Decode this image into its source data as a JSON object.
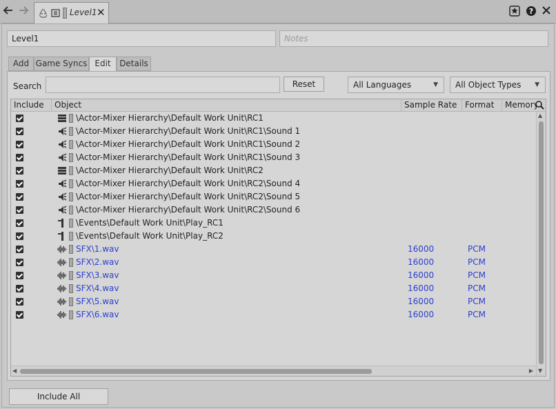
{
  "window": {
    "tab_title": "Level1",
    "back_icon": "arrow-left-icon",
    "forward_icon": "arrow-right-icon",
    "close_glyph": "✕"
  },
  "form": {
    "name_value": "Level1",
    "notes_placeholder": "Notes"
  },
  "tabs": [
    {
      "label": "Add"
    },
    {
      "label": "Game Syncs"
    },
    {
      "label": "Edit"
    },
    {
      "label": "Details"
    }
  ],
  "active_tab": "Edit",
  "search": {
    "label": "Search",
    "value": "",
    "reset_label": "Reset"
  },
  "filters": {
    "language": "All Languages",
    "object_types": "All Object Types"
  },
  "table": {
    "columns": [
      "Include",
      "Object",
      "Sample Rate",
      "Format",
      "Memory"
    ],
    "rows": [
      {
        "included": true,
        "icon": "container-icon",
        "object": "\\Actor-Mixer Hierarchy\\Default Work Unit\\RC1",
        "sample_rate": "",
        "format": "",
        "audio": false
      },
      {
        "included": true,
        "icon": "sound-icon",
        "object": "\\Actor-Mixer Hierarchy\\Default Work Unit\\RC1\\Sound 1",
        "sample_rate": "",
        "format": "",
        "audio": false
      },
      {
        "included": true,
        "icon": "sound-icon",
        "object": "\\Actor-Mixer Hierarchy\\Default Work Unit\\RC1\\Sound 2",
        "sample_rate": "",
        "format": "",
        "audio": false
      },
      {
        "included": true,
        "icon": "sound-icon",
        "object": "\\Actor-Mixer Hierarchy\\Default Work Unit\\RC1\\Sound 3",
        "sample_rate": "",
        "format": "",
        "audio": false
      },
      {
        "included": true,
        "icon": "container-icon",
        "object": "\\Actor-Mixer Hierarchy\\Default Work Unit\\RC2",
        "sample_rate": "",
        "format": "",
        "audio": false
      },
      {
        "included": true,
        "icon": "sound-icon",
        "object": "\\Actor-Mixer Hierarchy\\Default Work Unit\\RC2\\Sound 4",
        "sample_rate": "",
        "format": "",
        "audio": false
      },
      {
        "included": true,
        "icon": "sound-icon",
        "object": "\\Actor-Mixer Hierarchy\\Default Work Unit\\RC2\\Sound 5",
        "sample_rate": "",
        "format": "",
        "audio": false
      },
      {
        "included": true,
        "icon": "sound-icon",
        "object": "\\Actor-Mixer Hierarchy\\Default Work Unit\\RC2\\Sound 6",
        "sample_rate": "",
        "format": "",
        "audio": false
      },
      {
        "included": true,
        "icon": "event-icon",
        "object": "\\Events\\Default Work Unit\\Play_RC1",
        "sample_rate": "",
        "format": "",
        "audio": false
      },
      {
        "included": true,
        "icon": "event-icon",
        "object": "\\Events\\Default Work Unit\\Play_RC2",
        "sample_rate": "",
        "format": "",
        "audio": false
      },
      {
        "included": true,
        "icon": "waveform-icon",
        "object": "SFX\\1.wav",
        "sample_rate": "16000",
        "format": "PCM",
        "audio": true
      },
      {
        "included": true,
        "icon": "waveform-icon",
        "object": "SFX\\2.wav",
        "sample_rate": "16000",
        "format": "PCM",
        "audio": true
      },
      {
        "included": true,
        "icon": "waveform-icon",
        "object": "SFX\\3.wav",
        "sample_rate": "16000",
        "format": "PCM",
        "audio": true
      },
      {
        "included": true,
        "icon": "waveform-icon",
        "object": "SFX\\4.wav",
        "sample_rate": "16000",
        "format": "PCM",
        "audio": true
      },
      {
        "included": true,
        "icon": "waveform-icon",
        "object": "SFX\\5.wav",
        "sample_rate": "16000",
        "format": "PCM",
        "audio": true
      },
      {
        "included": true,
        "icon": "waveform-icon",
        "object": "SFX\\6.wav",
        "sample_rate": "16000",
        "format": "PCM",
        "audio": true
      }
    ]
  },
  "footer": {
    "include_all_label": "Include All"
  },
  "colors": {
    "audio_text": "#2b3fcc",
    "background": "#c9c9c9"
  }
}
